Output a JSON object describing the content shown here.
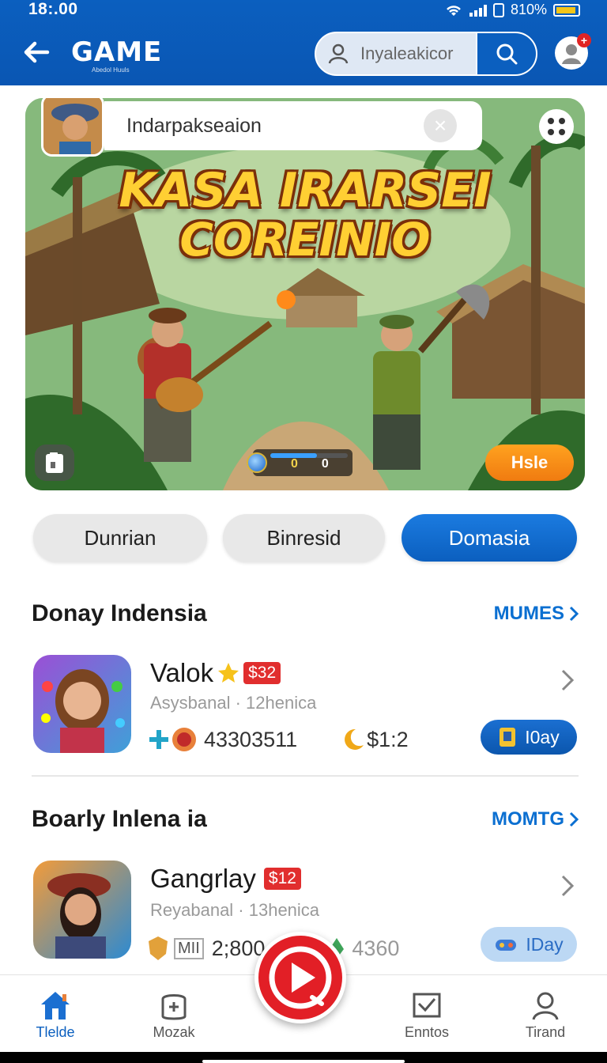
{
  "status": {
    "time": "18:.00",
    "battery": "810%"
  },
  "header": {
    "logo": "GAME",
    "logo_sub": "Abedol Huuls",
    "search_value": "Inyaleakicor"
  },
  "banner": {
    "caption": "Indarpakseaion",
    "title_line1": "KASA IRARSEI",
    "title_line2": "COREINIO",
    "hud_value": "0",
    "hud_zero": "0",
    "play_label": "Hsle",
    "hud_fill": 0.6
  },
  "chips": [
    {
      "label": "Dunrian",
      "active": false
    },
    {
      "label": "Binresid",
      "active": false
    },
    {
      "label": "Domasia",
      "active": true
    }
  ],
  "sections": [
    {
      "title": "Donay Indensia",
      "more": "MUMES",
      "item": {
        "name": "Valok",
        "price": "$32",
        "meta": "Asysbanal · 12henica",
        "count": "43303511",
        "cost": "$1:2",
        "action": "I0ay"
      }
    },
    {
      "title": "Boarly Inlena ia",
      "more": "MOMTG",
      "item": {
        "name": "Gangrlay",
        "price": "$12",
        "meta": "Reyabanal · 13henica",
        "badge": "MII",
        "count": "2;800",
        "extra": "4360",
        "action": "IDay"
      }
    }
  ],
  "nav": [
    {
      "label": "Tlelde",
      "icon": "home-icon",
      "active": true
    },
    {
      "label": "Mozak",
      "icon": "gamepad-icon",
      "active": false
    },
    {
      "label": "Enntos",
      "icon": "mail-icon",
      "active": false
    },
    {
      "label": "Tirand",
      "icon": "profile-icon",
      "active": false
    }
  ],
  "colors": {
    "brand": "#0b5fbf",
    "accent_red": "#e21f26",
    "play_orange": "#f58e16"
  }
}
